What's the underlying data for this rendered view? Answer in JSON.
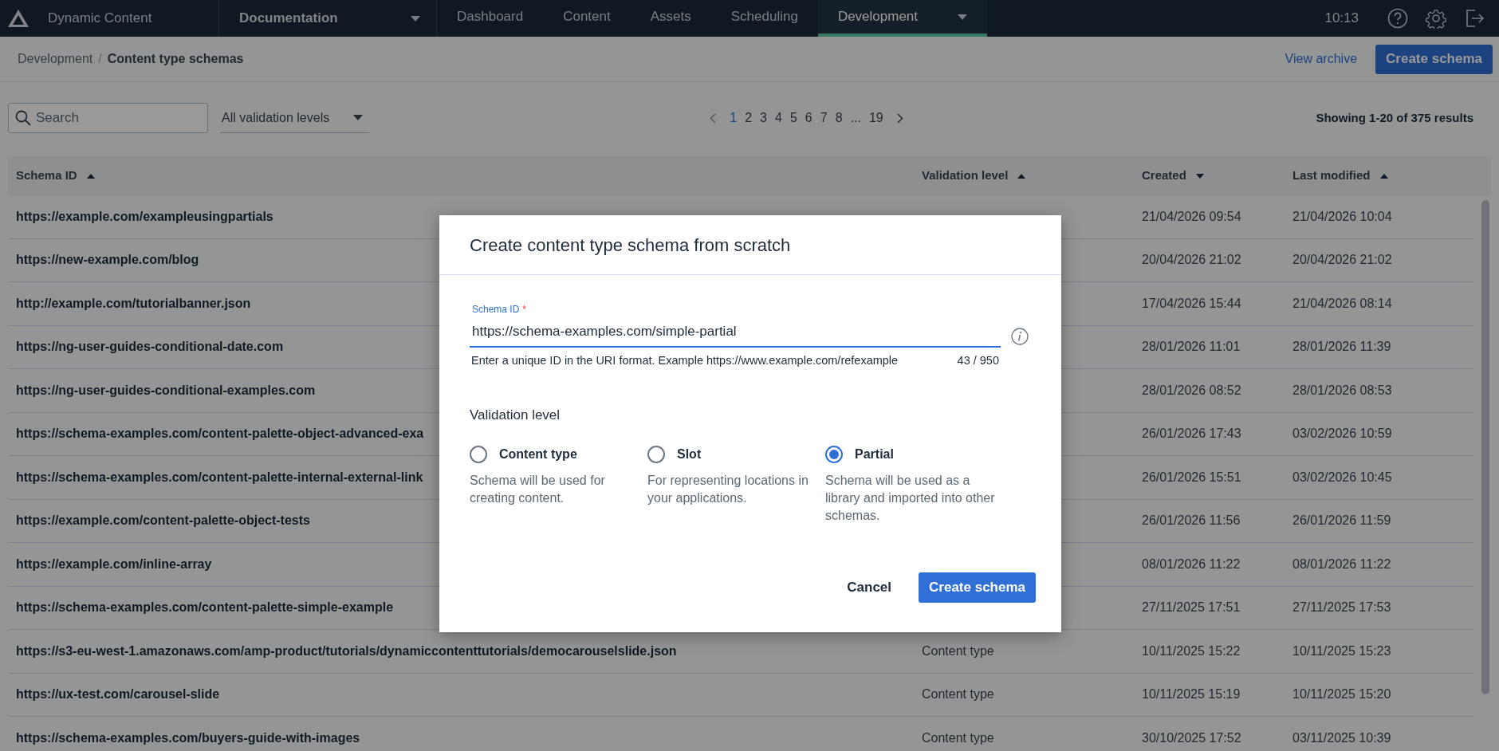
{
  "app": {
    "name": "Dynamic Content"
  },
  "nav": {
    "hub": "Documentation",
    "tabs": [
      {
        "label": "Dashboard",
        "selected": false
      },
      {
        "label": "Content",
        "selected": false
      },
      {
        "label": "Assets",
        "selected": false
      },
      {
        "label": "Scheduling",
        "selected": false
      },
      {
        "label": "Development",
        "selected": true
      }
    ],
    "clock": "10:13"
  },
  "breadcrumb": {
    "items": [
      "Development",
      "Content type schemas"
    ],
    "separator": "/"
  },
  "actions": {
    "view_archive": "View archive",
    "create": "Create schema"
  },
  "search": {
    "placeholder": "Search"
  },
  "filter": {
    "value": "All validation levels"
  },
  "pagination": {
    "pages": [
      {
        "label": "1",
        "selected": true
      },
      {
        "label": "2",
        "selected": false
      },
      {
        "label": "3",
        "selected": false
      },
      {
        "label": "4",
        "selected": false
      },
      {
        "label": "5",
        "selected": false
      },
      {
        "label": "6",
        "selected": false
      },
      {
        "label": "7",
        "selected": false
      },
      {
        "label": "8",
        "selected": false
      },
      {
        "label": "...",
        "selected": false
      },
      {
        "label": "19",
        "selected": false
      }
    ]
  },
  "results": "Showing 1-20 of 375 results",
  "table": {
    "columns": [
      {
        "label": "Schema ID",
        "ascending": true
      },
      {
        "label": "Validation level",
        "ascending": true
      },
      {
        "label": "Created",
        "ascending": false
      },
      {
        "label": "Last modified",
        "ascending": true
      }
    ],
    "rows": [
      {
        "schema_id": "https://example.com/exampleusingpartials",
        "created": "21/04/2026 09:54",
        "modified": "21/04/2026 10:04"
      },
      {
        "schema_id": "https://new-example.com/blog",
        "created": "20/04/2026 21:02",
        "modified": "20/04/2026 21:02"
      },
      {
        "schema_id": "http://example.com/tutorialbanner.json",
        "created": "17/04/2026 15:44",
        "modified": "21/04/2026 08:14"
      },
      {
        "schema_id": "https://ng-user-guides-conditional-date.com",
        "created": "28/01/2026 11:01",
        "modified": "28/01/2026 11:39"
      },
      {
        "schema_id": "https://ng-user-guides-conditional-examples.com",
        "created": "28/01/2026 08:52",
        "modified": "28/01/2026 08:53"
      },
      {
        "schema_id": "https://schema-examples.com/content-palette-object-advanced-exa",
        "created": "26/01/2026 17:43",
        "modified": "03/02/2026 10:59"
      },
      {
        "schema_id": "https://schema-examples.com/content-palette-internal-external-link",
        "created": "26/01/2026 15:51",
        "modified": "03/02/2026 10:45"
      },
      {
        "schema_id": "https://example.com/content-palette-object-tests",
        "created": "26/01/2026 11:56",
        "modified": "26/01/2026 11:59"
      },
      {
        "schema_id": "https://example.com/inline-array",
        "created": "08/01/2026 11:22",
        "modified": "08/01/2026 11:22"
      },
      {
        "schema_id": "https://schema-examples.com/content-palette-simple-example",
        "created": "27/11/2025 17:51",
        "modified": "27/11/2025 17:53"
      },
      {
        "schema_id": "https://s3-eu-west-1.amazonaws.com/amp-product/tutorials/dynamiccontenttutorials/democarouselslide.json",
        "validation_level": "Content type",
        "created": "10/11/2025 15:22",
        "modified": "10/11/2025 15:23"
      },
      {
        "schema_id": "https://ux-test.com/carousel-slide",
        "validation_level": "Content type",
        "created": "10/11/2025 15:19",
        "modified": "10/11/2025 15:20"
      },
      {
        "schema_id": "https://schema-examples.com/buyers-guide-with-images",
        "validation_level": "Content type",
        "created": "30/10/2025 17:52",
        "modified": "03/11/2025 10:39"
      }
    ]
  },
  "dialog": {
    "title": "Create content type schema from scratch",
    "field": {
      "label": "Schema ID",
      "required_mark": "*",
      "value": "https://schema-examples.com/simple-partial",
      "helper": "Enter a unique ID in the URI format. Example https://www.example.com/refexample",
      "counter": "43 / 950"
    },
    "section": "Validation level",
    "options": [
      {
        "label": "Content type",
        "description": "Schema will be used for creating content.",
        "selected": false
      },
      {
        "label": "Slot",
        "description": "For representing locations in your applications.",
        "selected": false
      },
      {
        "label": "Partial",
        "description": "Schema will be used as a library and imported into other schemas.",
        "selected": true
      }
    ],
    "buttons": {
      "cancel": "Cancel",
      "confirm": "Create schema"
    }
  }
}
